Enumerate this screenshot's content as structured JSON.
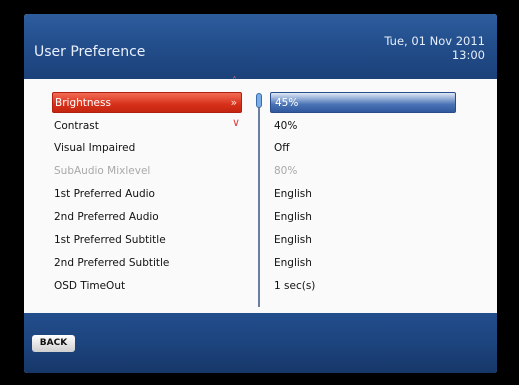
{
  "header": {
    "title": "User Preference",
    "date": "Tue, 01 Nov 2011",
    "time": "13:00"
  },
  "settings": [
    {
      "label": "Brightness",
      "value": "45%",
      "state": "selected"
    },
    {
      "label": "Contrast",
      "value": "40%",
      "state": "normal"
    },
    {
      "label": "Visual Impaired",
      "value": "Off",
      "state": "normal"
    },
    {
      "label": "SubAudio Mixlevel",
      "value": "80%",
      "state": "disabled"
    },
    {
      "label": "1st Preferred Audio",
      "value": "English",
      "state": "normal"
    },
    {
      "label": "2nd Preferred Audio",
      "value": "English",
      "state": "normal"
    },
    {
      "label": "1st Preferred Subtitle",
      "value": "English",
      "state": "normal"
    },
    {
      "label": "2nd Preferred Subtitle",
      "value": "English",
      "state": "normal"
    },
    {
      "label": "OSD TimeOut",
      "value": "1 sec(s)",
      "state": "normal"
    }
  ],
  "selected_marker": "»",
  "footer": {
    "back_label": "BACK"
  },
  "colors": {
    "header_blue": "#24508e",
    "selected_red": "#d6301a",
    "selected_value_blue": "#4a73b6"
  },
  "icons": {
    "scroll_up": "chevron-up-icon",
    "scroll_down": "chevron-down-icon"
  }
}
